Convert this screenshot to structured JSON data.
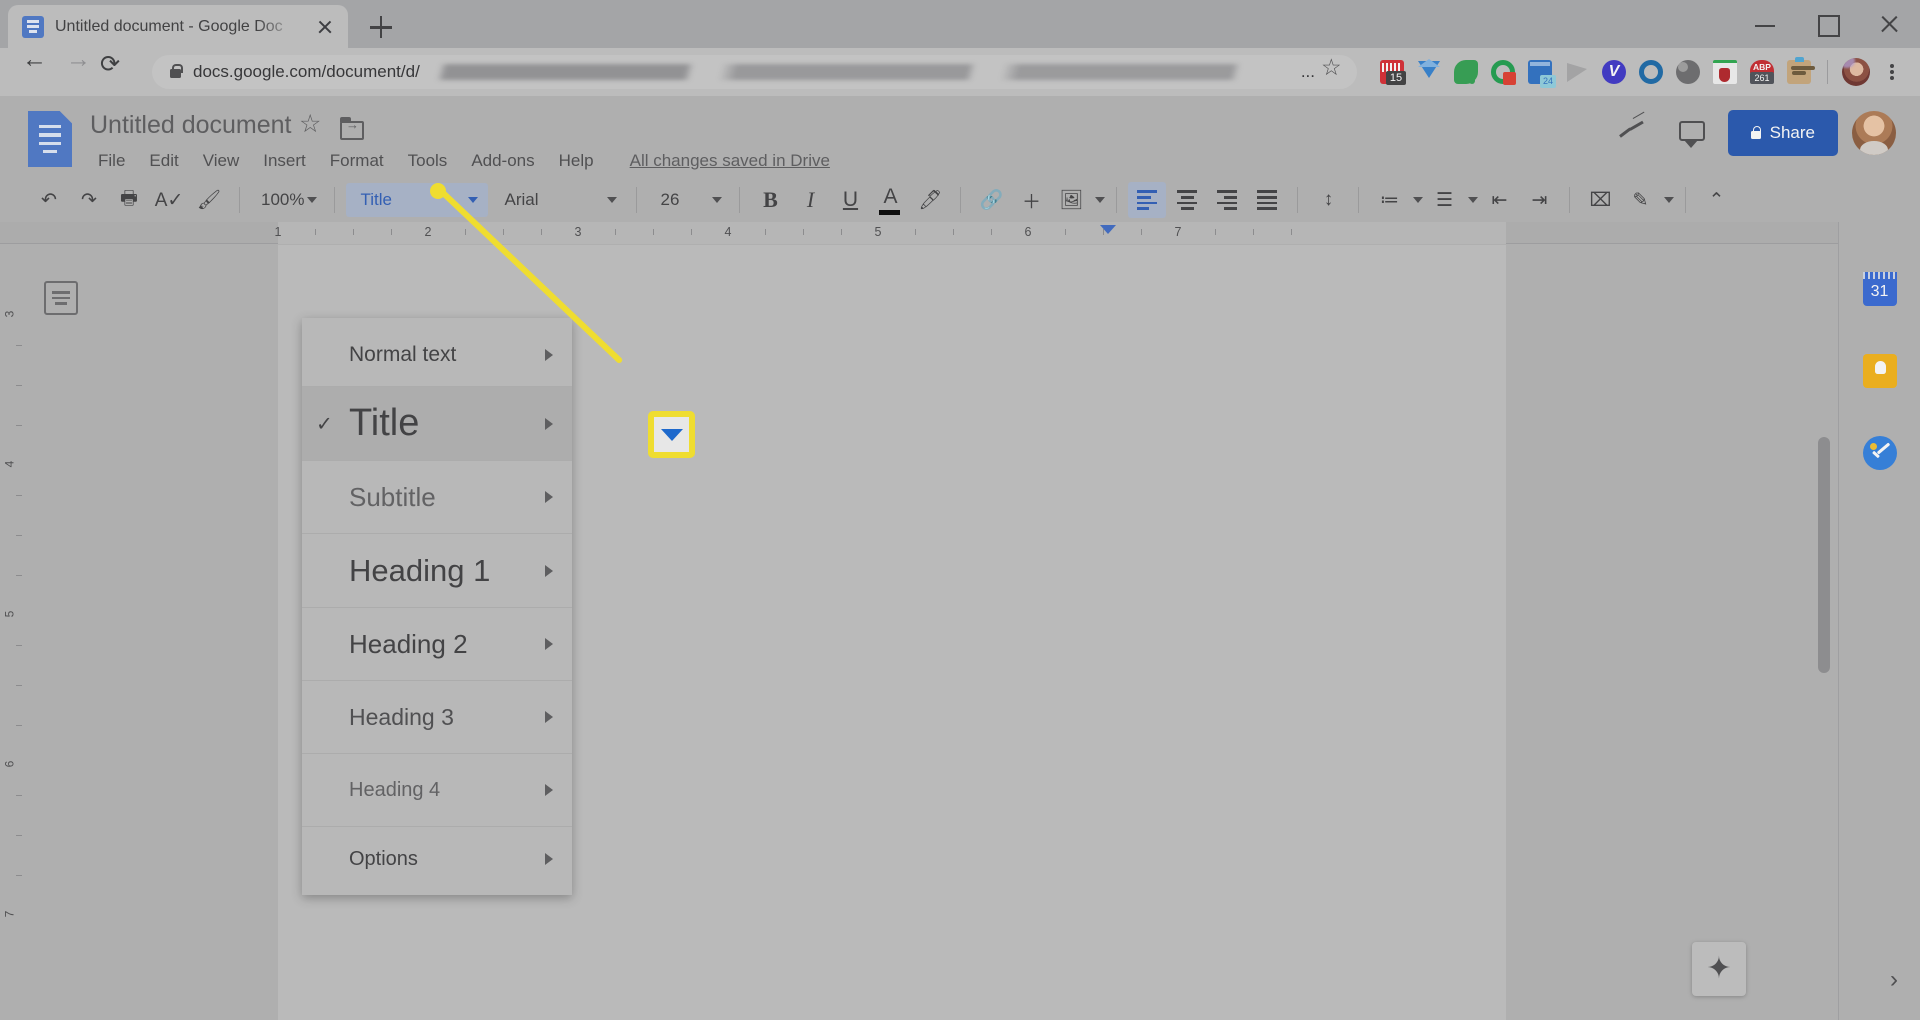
{
  "browser": {
    "tab": {
      "title": "Untitled document - Google Doc",
      "favicon": "docs-favicon",
      "close": "×",
      "new_tab": "+"
    },
    "window_controls": {
      "minimize": "—",
      "maximize": "□",
      "close": "×"
    },
    "nav": {
      "back": "←",
      "forward": "→",
      "reload": "⟳"
    },
    "omnibox": {
      "lock": "lock-icon",
      "url": "docs.google.com/document/d/",
      "url_suffix": "...",
      "bookmark": "☆"
    },
    "extensions": [
      {
        "name": "calendar-extension",
        "badge": "15"
      },
      {
        "name": "diamond-extension",
        "badge": ""
      },
      {
        "name": "evernote-extension",
        "badge": ""
      },
      {
        "name": "grammarly-extension",
        "badge": ""
      },
      {
        "name": "blue-calendar-extension",
        "badge": "24"
      },
      {
        "name": "gray-wedge-extension",
        "badge": ""
      },
      {
        "name": "v-extension",
        "badge": ""
      },
      {
        "name": "o-extension",
        "badge": ""
      },
      {
        "name": "moon-extension",
        "badge": ""
      },
      {
        "name": "shield-extension",
        "badge": ""
      },
      {
        "name": "adblock-plus-extension",
        "badge": "261"
      },
      {
        "name": "box-extension",
        "badge": ""
      }
    ],
    "profile": "profile-avatar",
    "menu": "⋮"
  },
  "docs": {
    "logo": "google-docs-logo",
    "document_title": "Untitled document",
    "star": "☆",
    "move_to_folder": "move-to-folder-icon",
    "menus": [
      "File",
      "Edit",
      "View",
      "Insert",
      "Format",
      "Tools",
      "Add-ons",
      "Help"
    ],
    "save_state": "All changes saved in Drive",
    "activity_icon": "activity-dashboard-icon",
    "comments_icon": "comments-icon",
    "share_label": "Share",
    "account_avatar": "account-avatar"
  },
  "toolbar": {
    "undo": "undo-icon",
    "redo": "redo-icon",
    "print": "print-icon",
    "spellcheck": "spellcheck-icon",
    "paint_format": "paint-format-icon",
    "zoom_value": "100%",
    "paragraph_style": "Title",
    "font_family": "Arial",
    "font_size": "26",
    "bold": "B",
    "italic": "I",
    "underline": "U",
    "text_color": "A",
    "highlight": "highlight-icon",
    "insert_link": "link-icon",
    "add_comment": "add-comment-icon",
    "insert_image": "insert-image-icon",
    "align_left": "align-left-icon",
    "align_center": "align-center-icon",
    "align_right": "align-right-icon",
    "align_justify": "align-justify-icon",
    "line_spacing": "line-spacing-icon",
    "numbered_list": "numbered-list-icon",
    "bulleted_list": "bulleted-list-icon",
    "decrease_indent": "decrease-indent-icon",
    "increase_indent": "increase-indent-icon",
    "clear_formatting": "clear-formatting-icon",
    "editing_mode": "editing-mode-icon",
    "collapse_toolbar": "collapse-toolbar-icon"
  },
  "ruler": {
    "numbers": [
      "1",
      "2",
      "3",
      "4",
      "5",
      "6",
      "7"
    ],
    "vertical_numbers": [
      "3",
      "4",
      "5",
      "6",
      "7"
    ]
  },
  "style_menu": {
    "items": [
      {
        "label": "Normal text",
        "selected": false,
        "has_submenu": true
      },
      {
        "label": "Title",
        "selected": true,
        "has_submenu": true
      },
      {
        "label": "Subtitle",
        "selected": false,
        "has_submenu": true
      },
      {
        "label": "Heading 1",
        "selected": false,
        "has_submenu": true
      },
      {
        "label": "Heading 2",
        "selected": false,
        "has_submenu": true
      },
      {
        "label": "Heading 3",
        "selected": false,
        "has_submenu": true
      },
      {
        "label": "Heading 4",
        "selected": false,
        "has_submenu": true
      },
      {
        "label": "Options",
        "selected": false,
        "has_submenu": true
      }
    ],
    "check_glyph": "✓"
  },
  "sidebar": {
    "calendar": "31",
    "keep": "google-keep-icon",
    "tasks": "google-tasks-icon",
    "expand": "›"
  },
  "document": {
    "outline_toggle": "document-outline-icon",
    "explore": "explore-icon"
  },
  "annotation": {
    "callout_target": "paragraph-style-dropdown-arrow",
    "highlight_color": "#fbe726",
    "arrow_color": "#1266d4"
  }
}
